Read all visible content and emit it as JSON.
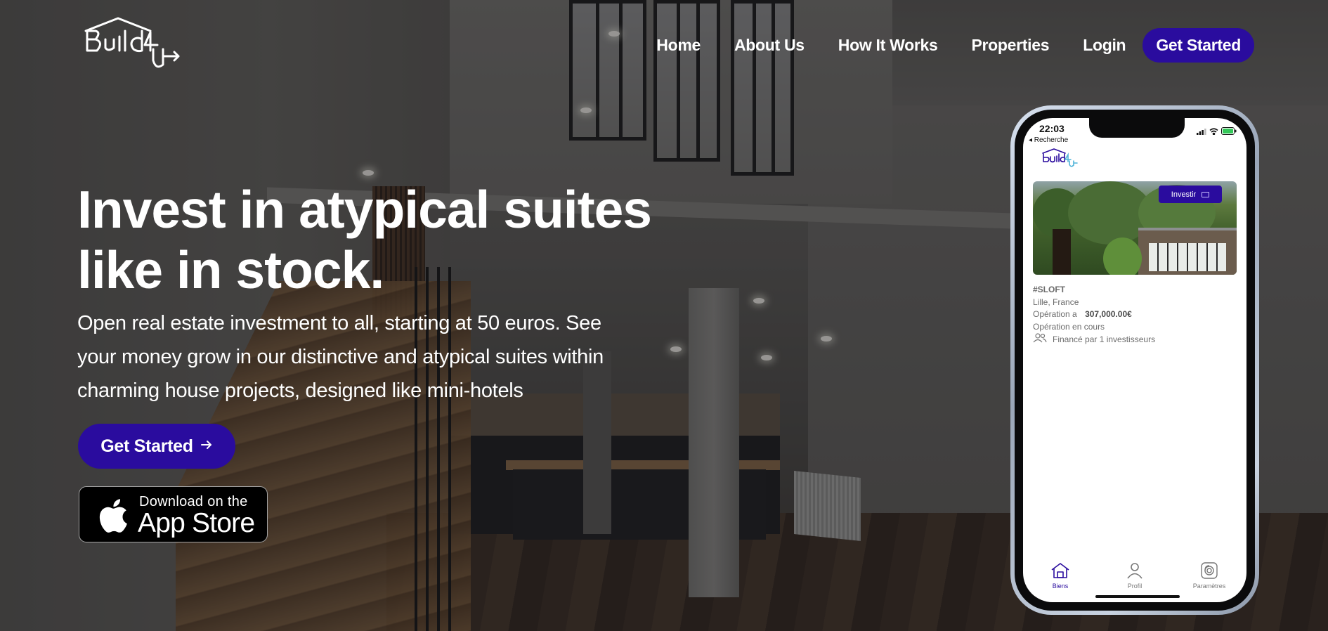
{
  "brand": {
    "logo_text": "Build4U",
    "primary_color": "#2a0c9e"
  },
  "nav": {
    "items": [
      {
        "label": "Home"
      },
      {
        "label": "About Us"
      },
      {
        "label": "How It Works"
      },
      {
        "label": "Properties"
      },
      {
        "label": "Login"
      }
    ],
    "cta_label": "Get Started"
  },
  "hero": {
    "title_line1": "Invest in atypical suites",
    "title_line2": "like in stock.",
    "subtitle_line1": "Open real estate investment to all, starting at 50 euros. See",
    "subtitle_line2": "your money grow in our distinctive and atypical suites within",
    "subtitle_line3": "charming house projects, designed like mini-hotels",
    "cta_label": "Get Started",
    "cta_icon": "arrow-right-icon",
    "appstore": {
      "small": "Download on the",
      "big": "App Store",
      "icon": "apple-icon"
    }
  },
  "phone": {
    "status_time": "22:03",
    "back_label": "◂ Recherche",
    "card": {
      "invest_label": "Investir",
      "tag": "#SLOFT",
      "location": "Lille, France",
      "operation_label": "Opération a",
      "operation_amount": "307,000.00€",
      "status": "Opération en cours",
      "funded": "Financé par 1 investisseurs"
    },
    "tabs": [
      {
        "label": "Biens",
        "icon": "house-icon",
        "active": true
      },
      {
        "label": "Profil",
        "icon": "user-icon",
        "active": false
      },
      {
        "label": "Paramètres",
        "icon": "fingerprint-icon",
        "active": false
      }
    ]
  }
}
